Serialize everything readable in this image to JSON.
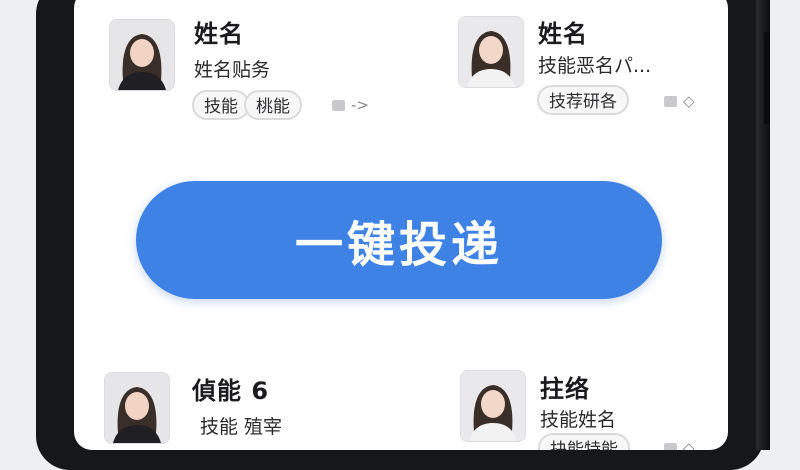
{
  "cards": [
    {
      "name": "姓名",
      "subtitle": "姓名贴务",
      "tags": [
        "技能",
        "桃能"
      ],
      "action": "->"
    },
    {
      "name": "姓名",
      "subtitle": "技能恶名パ...",
      "tags": [
        "技荐研各"
      ],
      "action": "◇"
    },
    {
      "name": "偵能 6",
      "subtitle": "技能 殖宰",
      "tags": [],
      "action": ""
    },
    {
      "name": "拄络",
      "subtitle": "技能姓名",
      "tags": [
        "抉能特能"
      ],
      "action": "◇"
    }
  ],
  "primary_action": {
    "label": "一键投递"
  },
  "colors": {
    "accent": "#3f82e6",
    "tag_border": "#dadadd"
  },
  "icons": {
    "avatar": "user-photo-icon",
    "action_marker": "placeholder-square-icon"
  }
}
